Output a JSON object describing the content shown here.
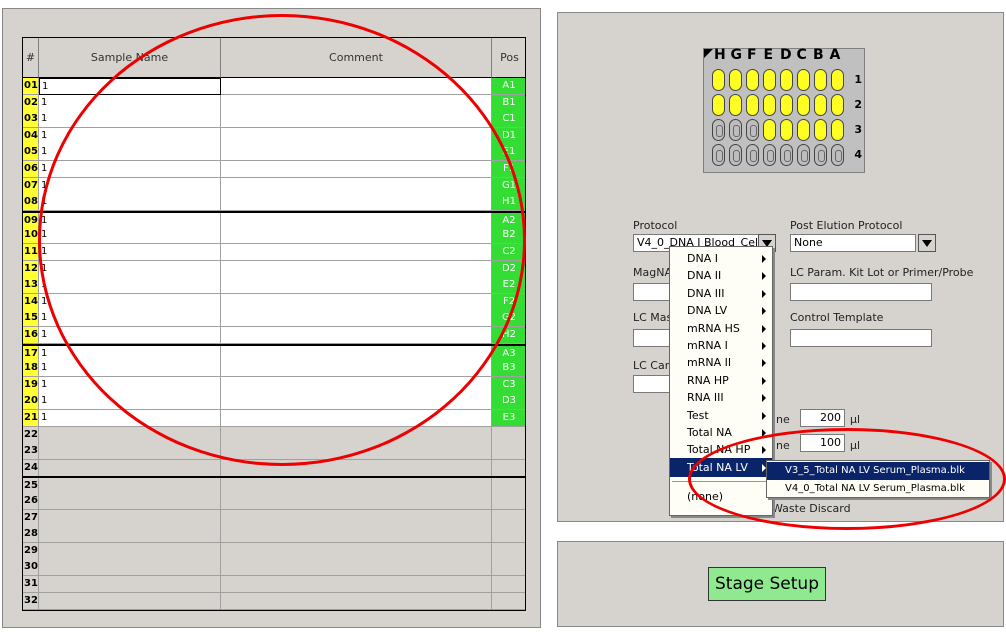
{
  "table": {
    "headers": {
      "num": "#",
      "sample_name": "Sample Name",
      "comment": "Comment",
      "pos": "Pos"
    },
    "rows": [
      {
        "num": "01",
        "name": "1",
        "pos": "A1"
      },
      {
        "num": "02",
        "name": "1",
        "pos": "B1"
      },
      {
        "num": "03",
        "name": "1",
        "pos": "C1"
      },
      {
        "num": "04",
        "name": "1",
        "pos": "D1"
      },
      {
        "num": "05",
        "name": "1",
        "pos": "E1"
      },
      {
        "num": "06",
        "name": "1",
        "pos": "F1"
      },
      {
        "num": "07",
        "name": "1",
        "pos": "G1"
      },
      {
        "num": "08",
        "name": "1",
        "pos": "H1"
      },
      {
        "num": "09",
        "name": "1",
        "pos": "A2"
      },
      {
        "num": "10",
        "name": "1",
        "pos": "B2"
      },
      {
        "num": "11",
        "name": "1",
        "pos": "C2"
      },
      {
        "num": "12",
        "name": "1",
        "pos": "D2"
      },
      {
        "num": "13",
        "name": "1",
        "pos": "E2"
      },
      {
        "num": "14",
        "name": "1",
        "pos": "F2"
      },
      {
        "num": "15",
        "name": "1",
        "pos": "G2"
      },
      {
        "num": "16",
        "name": "1",
        "pos": "H2"
      },
      {
        "num": "17",
        "name": "1",
        "pos": "A3"
      },
      {
        "num": "18",
        "name": "1",
        "pos": "B3"
      },
      {
        "num": "19",
        "name": "1",
        "pos": "C3"
      },
      {
        "num": "20",
        "name": "1",
        "pos": "D3"
      },
      {
        "num": "21",
        "name": "1",
        "pos": "E3"
      },
      {
        "num": "22",
        "name": "",
        "pos": ""
      },
      {
        "num": "23",
        "name": "",
        "pos": ""
      },
      {
        "num": "24",
        "name": "",
        "pos": ""
      },
      {
        "num": "25",
        "name": "",
        "pos": ""
      },
      {
        "num": "26",
        "name": "",
        "pos": ""
      },
      {
        "num": "27",
        "name": "",
        "pos": ""
      },
      {
        "num": "28",
        "name": "",
        "pos": ""
      },
      {
        "num": "29",
        "name": "",
        "pos": ""
      },
      {
        "num": "30",
        "name": "",
        "pos": ""
      },
      {
        "num": "31",
        "name": "",
        "pos": ""
      },
      {
        "num": "32",
        "name": "",
        "pos": ""
      }
    ]
  },
  "plate": {
    "col_labels": [
      "H",
      "G",
      "F",
      "E",
      "D",
      "C",
      "B",
      "A"
    ],
    "row_labels": [
      "1",
      "2",
      "3",
      "4"
    ],
    "filled_wells_per_row": [
      8,
      8,
      5,
      0
    ]
  },
  "form": {
    "protocol_label": "Protocol",
    "protocol_value": "V4_0_DNA I Blood_Cell",
    "post_elution_label": "Post Elution Protocol",
    "post_elution_value": "None",
    "magna_label": "MagNA",
    "lc_param_label": "LC Param. Kit Lot or Primer/Probe",
    "lc_mas_label": "LC Mas",
    "control_template_label": "Control Template",
    "lc_car_label": "LC Car",
    "vol1_label": "ne",
    "vol1_value": "200",
    "vol1_unit": "µl",
    "vol2_label": "ne",
    "vol2_value": "100",
    "vol2_unit": "µl",
    "waste_label": "Waste Discard"
  },
  "menu": {
    "items": [
      "DNA I",
      "DNA II",
      "DNA III",
      "DNA LV",
      "mRNA HS",
      "mRNA I",
      "mRNA II",
      "RNA HP",
      "RNA III",
      "Test",
      "Total NA",
      "Total NA HP",
      "Total NA LV"
    ],
    "none_item": "(none)",
    "highlighted": "Total NA LV"
  },
  "submenu": {
    "items": [
      "V3_5_Total NA LV Serum_Plasma.blk",
      "V4_0_Total NA LV Serum_Plasma.blk"
    ],
    "highlighted": "V3_5_Total NA LV Serum_Plasma.blk"
  },
  "stage_button": "Stage Setup",
  "colors": {
    "sample_num_active": "#ffff33",
    "pos_active": "#33dd33",
    "menu_highlight": "#0a246a",
    "annotation": "#ee0000",
    "stage_button": "#8fe98f"
  }
}
